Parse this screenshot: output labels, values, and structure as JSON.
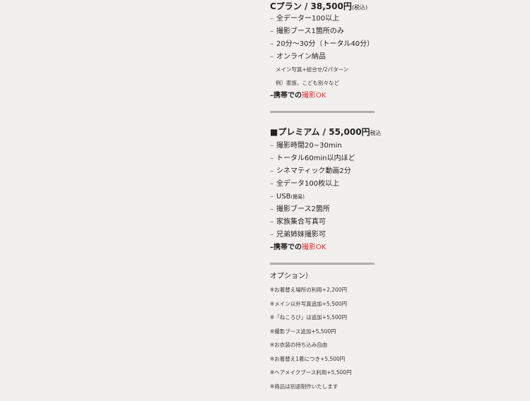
{
  "plan_c": {
    "title_main": "Cプラン / 38,500円",
    "title_tax": "(税込)",
    "items": [
      "全データー100以上",
      "撮影ブース1箇所のみ",
      "20分〜30分（トータル40分）",
      "オンライン納品"
    ],
    "sub_notes": [
      "メイン写真+総合せ/2パターン",
      "例）家族、こども別々など"
    ],
    "ok_prefix": "携帯での",
    "ok_highlight": "撮影OK"
  },
  "premium": {
    "title_main": "■プレミアム / 55,000円",
    "title_tax": "税込",
    "items": [
      "撮影時間20~30min",
      "トータル60min以内ほど",
      "シネマティック動画2分",
      "全データ100枚以上",
      "USB",
      "撮影ブース2箇所",
      "家族集合写真可",
      "兄弟姉妹撮影可"
    ],
    "usb_note": "(簡易)",
    "ok_prefix": "携帯での",
    "ok_highlight": "撮影OK"
  },
  "options": {
    "heading": "オプション）",
    "items": [
      "※お着替え場所の利用+2,200円",
      "※メイン以外写真追加+5,500円",
      "※「ねころび」は追加+5,500円",
      "※撮影ブース追加+5,500円",
      "※お衣装の持ち込み自由",
      "※お着替え1着につき+5,500円",
      "※ヘアメイクブース利用+5,500円",
      "※商品は別途制作いたします"
    ]
  },
  "dash": "–"
}
